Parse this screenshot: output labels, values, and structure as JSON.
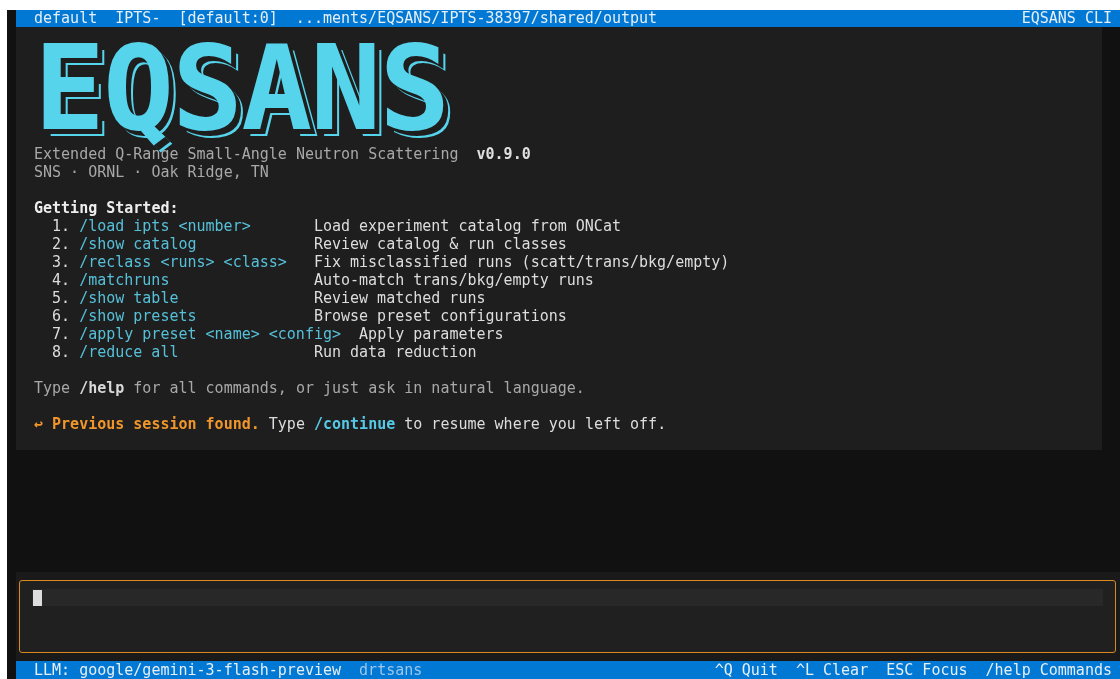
{
  "header": {
    "items": [
      "default",
      "IPTS-",
      "[default:0]",
      "...ments/EQSANS/IPTS-38397/shared/output"
    ],
    "title": "EQSANS CLI"
  },
  "banner": {
    "logo": "EQSANS",
    "subtitle": "Extended Q-Range Small-Angle Neutron Scattering",
    "version": "v0.9.0",
    "location": "SNS · ORNL · Oak Ridge, TN"
  },
  "getting_started": {
    "heading": "Getting Started:",
    "steps": [
      {
        "number": "1.",
        "command": "/load ipts <number>",
        "description": "Load experiment catalog from ONCat"
      },
      {
        "number": "2.",
        "command": "/show catalog",
        "description": "Review catalog & run classes"
      },
      {
        "number": "3.",
        "command": "/reclass <runs> <class>",
        "description": "Fix misclassified runs (scatt/trans/bkg/empty)"
      },
      {
        "number": "4.",
        "command": "/matchruns",
        "description": "Auto-match trans/bkg/empty runs"
      },
      {
        "number": "5.",
        "command": "/show table",
        "description": "Review matched runs"
      },
      {
        "number": "6.",
        "command": "/show presets",
        "description": "Browse preset configurations"
      },
      {
        "number": "7.",
        "command": "/apply preset <name> <config>",
        "description": "Apply parameters"
      },
      {
        "number": "8.",
        "command": "/reduce all",
        "description": "Run data reduction"
      }
    ]
  },
  "help_text": "Type **/help** for all commands, or just ask in natural language.",
  "session_notice": {
    "icon": "↩",
    "title": "Previous session found.",
    "text": "Type **/continue** to resume where you left off."
  },
  "input": {
    "focused": true
  },
  "status_bar": {
    "model": "LLM: google/gemini-3-flash-preview",
    "backend": "drtsans",
    "shortcuts": [
      "^Q Quit",
      "^L Clear",
      "ESC Focus",
      "/help Commands"
    ]
  }
}
